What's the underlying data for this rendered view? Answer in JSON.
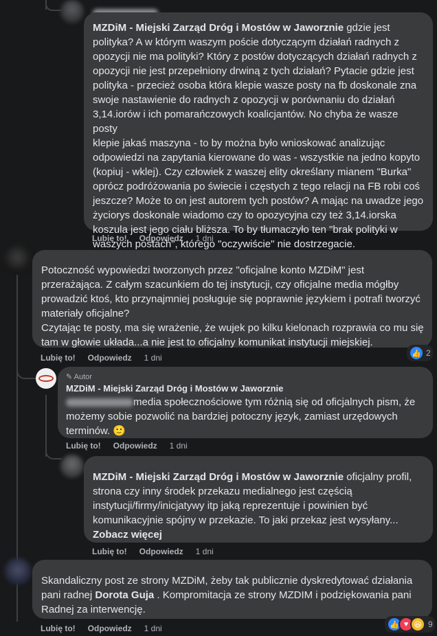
{
  "comment1": {
    "page_name": "MZDiM - Miejski Zarząd Dróg i Mostów w Jaworznie",
    "text_lines": [
      " gdzie jest",
      "polityka? A w którym waszym poście dotyczącym działań radnych z",
      "opozycji nie ma polityki? Który z postów dotyczących działań radnych z",
      "opozycji nie jest przepełniony drwiną z tych działań? Pytacie gdzie jest",
      "polityka - przecież osoba która klepie wasze posty na fb doskonale zna",
      "swoje nastawienie do radnych z opozycji w porównaniu do działań",
      "3,14.iorów i ich pomarańczowych koalicjantów. No chyba że wasze posty",
      "klepie jakaś maszyna - to by można było wnioskować analizując",
      "odpowiedzi na zapytania kierowane do was - wszystkie na jedno kopyto",
      "(kopiuj - wklej). Czy człowiek z waszej elity określany mianem \"Burka\"",
      "oprócz podróżowania po świecie i częstych z tego relacji na FB robi coś",
      "jeszcze? Może to on jest autorem tych postów? A mając na uwadze jego",
      "życiorys doskonale wiadomo czy to opozycyjna czy też 3,14.iorska",
      "koszula jest jego ciału bliższa. To by tłumaczyło ten \"brak polityki w",
      "waszych postach\", którego \"oczywiście\" nie dostrzegacie."
    ],
    "like": "Lubię to!",
    "reply": "Odpowiedz",
    "time": "1 dni"
  },
  "comment2": {
    "text_lines": [
      "Potoczność wypowiedzi tworzonych przez \"oficjalne konto MZDiM\" jest",
      "przerażająca. Z całym szacunkiem do tej instytucji, czy oficjalne media mógłby",
      "prowadzić ktoś, kto przynajmniej posługuje się poprawnie językiem i potrafi tworzyć",
      "materiały oficjalne?",
      "Czytając te posty, ma się wrażenie, że wujek po kilku kielonach rozprawia co mu się",
      "tam w głowie układa...a nie jest to oficjalny komunikat instytucji miejskiej."
    ],
    "like": "Lubię to!",
    "reply": "Odpowiedz",
    "time": "1 dni",
    "reaction_count": "2"
  },
  "reply1": {
    "badge": "Autor",
    "page_name": "MZDiM - Miejski Zarząd Dróg i Mostów w Jaworznie",
    "text_lines": [
      "media społecznościowe tym różnią się od oficjalnych pism, że",
      "możemy sobie pozwolić na bardziej potoczny język, zamiast urzędowych",
      "terminów. "
    ],
    "emoji": "🙂",
    "like": "Lubię to!",
    "reply": "Odpowiedz",
    "time": "1 dni"
  },
  "reply2": {
    "page_name": "MZDiM - Miejski Zarząd Dróg i Mostów w Jaworznie",
    "text_lines": [
      " oficjalny profil,",
      "strona czy inny środek przekazu medialnego jest częścią",
      "instytucji/firmy/inicjatywy itp jaką reprezentuje i powinien być",
      "komunikacyjnie spójny w przekazie. To jaki przekaz jest wysyłany..."
    ],
    "see_more": "Zobacz więcej",
    "like": "Lubię to!",
    "reply": "Odpowiedz",
    "time": "1 dni"
  },
  "comment3": {
    "line1": "Skandaliczny post ze strony MZDiM, żeby tak publicznie dyskredytować działania",
    "line2_before": "pani radnej ",
    "line2_name": "Dorota Guja",
    "line2_after": " . Kompromitacja ze strony MZDIM i podziękowania pani",
    "line3": "Radnej za interwencję.",
    "like": "Lubię to!",
    "reply": "Odpowiedz",
    "time": "1 dni",
    "reaction_count": "9"
  },
  "icons": {
    "like_color": "#2d88ff",
    "heart_color": "#f33e58",
    "haha_color": "#f7b928"
  }
}
